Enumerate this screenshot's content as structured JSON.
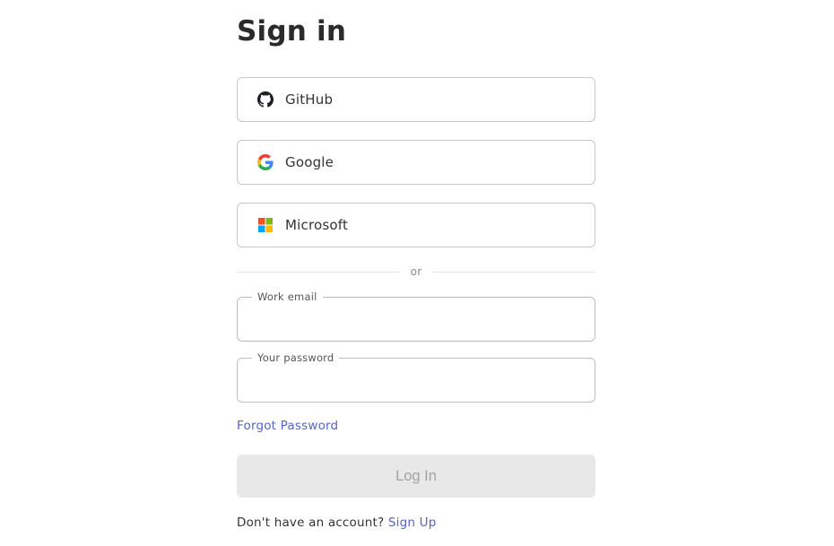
{
  "page": {
    "title": "Sign in"
  },
  "providers": [
    {
      "label": "GitHub",
      "icon": "github-icon"
    },
    {
      "label": "Google",
      "icon": "google-icon"
    },
    {
      "label": "Microsoft",
      "icon": "microsoft-icon"
    }
  ],
  "divider": {
    "text": "or"
  },
  "form": {
    "email": {
      "label": "Work email",
      "value": "",
      "placeholder": ""
    },
    "password": {
      "label": "Your password",
      "value": "",
      "placeholder": ""
    },
    "forgot_link": "Forgot Password",
    "submit_label": "Log In",
    "submit_disabled": true
  },
  "footer": {
    "prompt": "Don't have an account?",
    "signup_link": "Sign Up"
  },
  "colors": {
    "link": "#5563c1",
    "button_disabled_bg": "#e8e8e8",
    "button_disabled_text": "#a3a3a3",
    "border": "#c7c7c7"
  }
}
